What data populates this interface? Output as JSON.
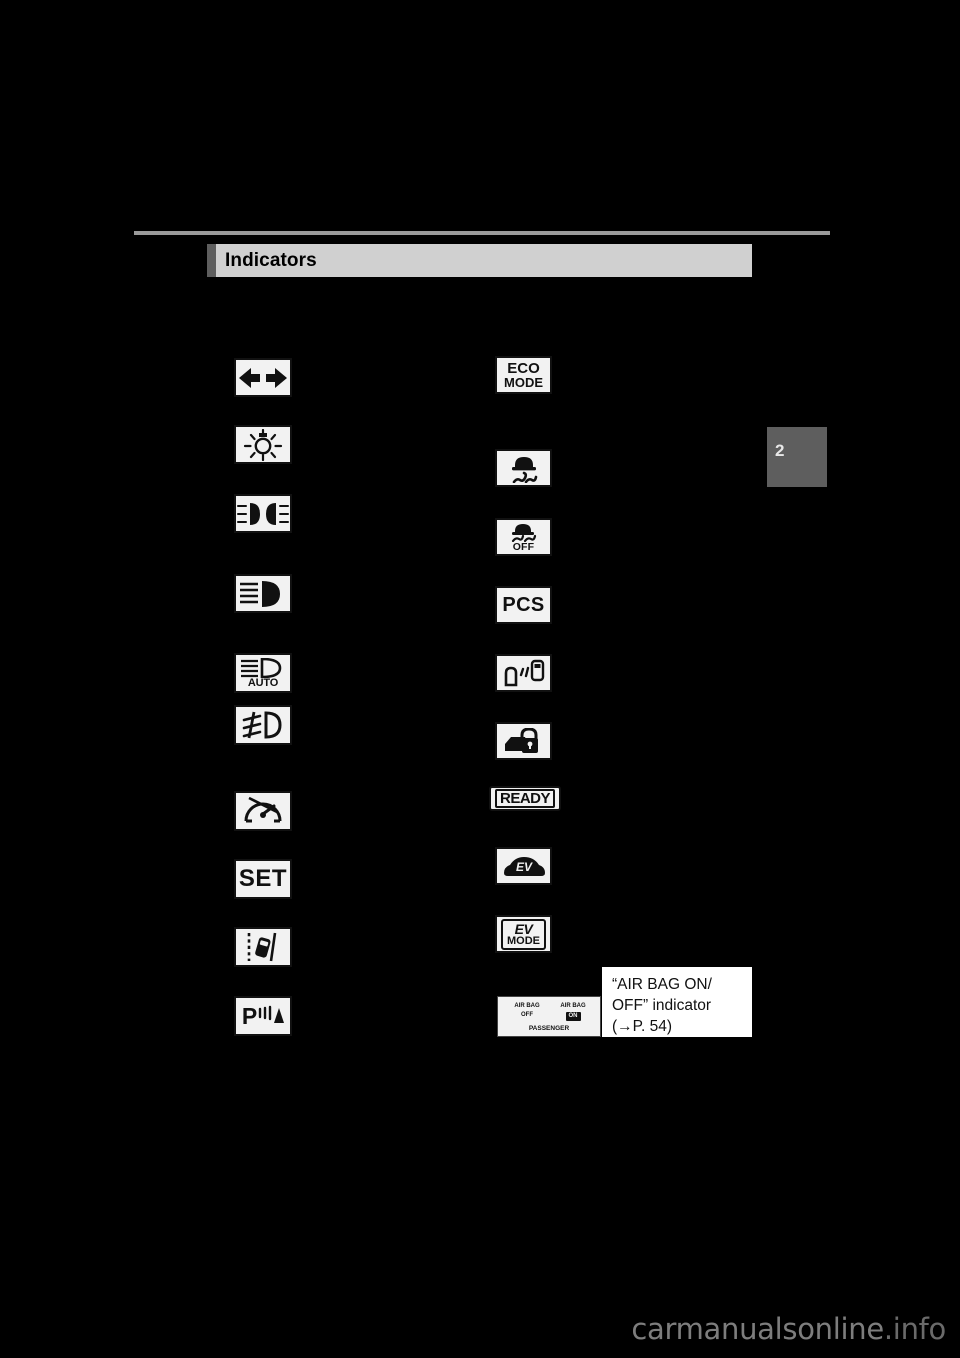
{
  "page": {
    "chapter_tab": "2",
    "watermark_name": "carmanualsonline",
    "watermark_tld": ".info"
  },
  "section": {
    "title": "Indicators"
  },
  "left_column": [
    {
      "id": "turn-signal",
      "label": "Turn signal indicators",
      "kind": "glyph"
    },
    {
      "id": "tail-light",
      "label": "Tail light indicator",
      "kind": "glyph"
    },
    {
      "id": "headlight",
      "label": "Headlight indicator",
      "kind": "glyph"
    },
    {
      "id": "high-beam",
      "label": "Headlight high beam indicator",
      "kind": "glyph"
    },
    {
      "id": "auto-high-beam",
      "label": "AUTO high beam indicator",
      "kind": "glyph",
      "text": "AUTO"
    },
    {
      "id": "front-fog-light",
      "label": "Front fog light indicator",
      "kind": "glyph"
    },
    {
      "id": "cruise-control",
      "label": "Cruise control indicator",
      "kind": "glyph"
    },
    {
      "id": "cruise-set",
      "label": "Cruise control SET indicator",
      "kind": "text",
      "text": "SET"
    },
    {
      "id": "lane-departure",
      "label": "Lane departure alert indicator",
      "kind": "glyph"
    },
    {
      "id": "parking-assist",
      "label": "Parking assist indicator",
      "kind": "glyph",
      "text": "P"
    }
  ],
  "right_column": [
    {
      "id": "eco-mode",
      "label": "ECO MODE indicator",
      "kind": "text",
      "line1": "ECO",
      "line2": "MODE"
    },
    {
      "id": "slip-vsc",
      "label": "Slip indicator",
      "kind": "glyph"
    },
    {
      "id": "vsc-off",
      "label": "VSC OFF indicator",
      "kind": "glyph",
      "text": "OFF"
    },
    {
      "id": "pcs",
      "label": "PCS warning indicator",
      "kind": "text",
      "text": "PCS"
    },
    {
      "id": "blind-spot-monitor",
      "label": "Blind Spot Monitor indicator",
      "kind": "glyph"
    },
    {
      "id": "security",
      "label": "Security indicator",
      "kind": "glyph"
    },
    {
      "id": "ready",
      "label": "READY indicator",
      "kind": "text",
      "text": "READY"
    },
    {
      "id": "ev-drive-mode",
      "label": "EV drive mode indicator",
      "kind": "glyph",
      "text": "EV"
    },
    {
      "id": "ev-mode",
      "label": "EV MODE indicator",
      "kind": "text",
      "line1": "EV",
      "line2": "MODE"
    }
  ],
  "airbag_indicator": {
    "label": "AIR BAG ON/OFF indicator panel",
    "left_line1": "AIR BAG",
    "left_line2": "OFF",
    "right_line1": "AIR BAG",
    "right_line2": "ON",
    "bottom": "PASSENGER"
  },
  "airbag_callout": {
    "line1": "“AIR    BAG    ON/",
    "line2": "OFF”        indicator",
    "line3": "(→P. 54)"
  }
}
